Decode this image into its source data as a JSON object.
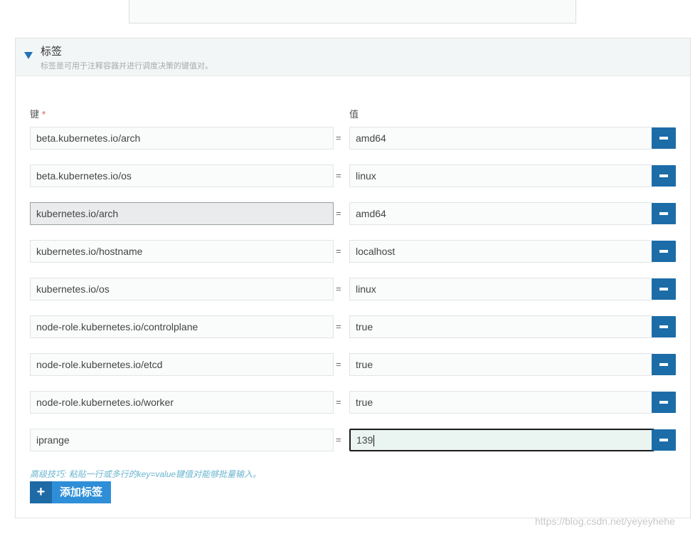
{
  "section": {
    "title": "标签",
    "subtitle": "标签是可用于注释容器并进行调度决策的键值对。"
  },
  "columns": {
    "key_label": "键",
    "required_mark": "*",
    "value_label": "值"
  },
  "equals_sign": "=",
  "labels": [
    {
      "key": "beta.kubernetes.io/arch",
      "value": "amd64"
    },
    {
      "key": "beta.kubernetes.io/os",
      "value": "linux"
    },
    {
      "key": "kubernetes.io/arch",
      "value": "amd64"
    },
    {
      "key": "kubernetes.io/hostname",
      "value": "localhost"
    },
    {
      "key": "kubernetes.io/os",
      "value": "linux"
    },
    {
      "key": "node-role.kubernetes.io/controlplane",
      "value": "true"
    },
    {
      "key": "node-role.kubernetes.io/etcd",
      "value": "true"
    },
    {
      "key": "node-role.kubernetes.io/worker",
      "value": "true"
    },
    {
      "key": "iprange",
      "value": "139"
    }
  ],
  "tip": "高级技巧: 粘贴一行或多行的key=value键值对能够批量输入。",
  "add_button": {
    "icon": "plus-icon",
    "label": "添加标签"
  },
  "watermark": "https://blog.csdn.net/yeyeyhehe",
  "colors": {
    "primary": "#1c6ca8",
    "add_button": "#2e8ed8",
    "tip": "#6ab5cf",
    "required": "#d9534f"
  }
}
